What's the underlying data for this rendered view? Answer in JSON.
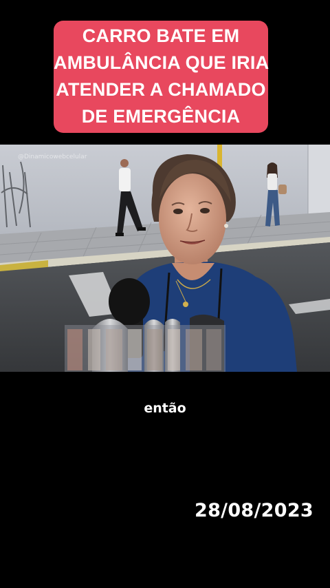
{
  "headline": {
    "lines": [
      "CARRO BATE EM",
      "AMBULÂNCIA QUE IRIA",
      "ATENDER A CHAMADO",
      "DE EMERGÊNCIA"
    ],
    "background_color": "#e8485e",
    "text_color": "#ffffff"
  },
  "video": {
    "watermark": "@Dinamicowebcelular",
    "scene": "woman-interview-street",
    "subtitle": "então"
  },
  "date_stamp": "28/08/2023",
  "colors": {
    "page_background": "#000000"
  }
}
